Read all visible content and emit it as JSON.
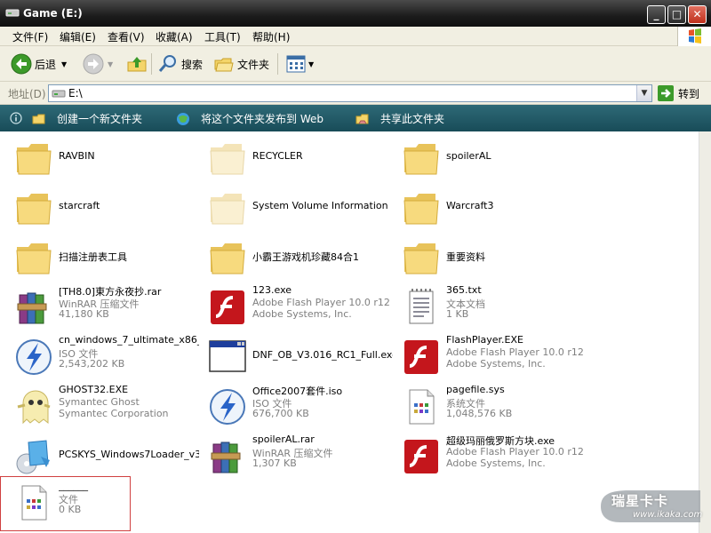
{
  "window": {
    "title": "Game (E:)",
    "min": "_",
    "max": "□",
    "close": "✕"
  },
  "menu": [
    "文件(F)",
    "编辑(E)",
    "查看(V)",
    "收藏(A)",
    "工具(T)",
    "帮助(H)"
  ],
  "toolbar": {
    "back": "后退",
    "search": "搜索",
    "folders": "文件夹"
  },
  "address": {
    "label": "地址(D)",
    "value": "E:\\",
    "go": "转到"
  },
  "tasks": [
    "创建一个新文件夹",
    "将这个文件夹发布到 Web",
    "共享此文件夹"
  ],
  "files": [
    {
      "name": "RAVBIN",
      "icon": "folder-icon"
    },
    {
      "name": "RECYCLER",
      "icon": "folder-hidden-icon"
    },
    {
      "name": "spoilerAL",
      "icon": "folder-icon"
    },
    {
      "name": "starcraft",
      "icon": "folder-icon"
    },
    {
      "name": "System Volume Information",
      "icon": "folder-hidden-icon"
    },
    {
      "name": "Warcraft3",
      "icon": "folder-icon"
    },
    {
      "name": "扫描注册表工具",
      "icon": "folder-icon"
    },
    {
      "name": "小霸王游戏机珍藏84合1",
      "icon": "folder-icon"
    },
    {
      "name": "重要资料",
      "icon": "folder-icon"
    },
    {
      "name": "[TH8.0]東方永夜抄.rar",
      "l2": "WinRAR 压缩文件",
      "l3": "41,180 KB",
      "icon": "winrar-icon"
    },
    {
      "name": "123.exe",
      "l2": "Adobe Flash Player 10.0 r12",
      "l3": "Adobe Systems, Inc.",
      "icon": "flash-icon"
    },
    {
      "name": "365.txt",
      "l2": "文本文档",
      "l3": "1 KB",
      "icon": "text-file-icon"
    },
    {
      "name": "cn_windows_7_ultimate_x86_...",
      "l2": "ISO 文件",
      "l3": "2,543,202 KB",
      "icon": "daemon-tools-icon"
    },
    {
      "name": "DNF_OB_V3.016_RC1_Full.exe",
      "l2": "",
      "l3": "",
      "icon": "window-app-icon"
    },
    {
      "name": "FlashPlayer.EXE",
      "l2": "Adobe Flash Player 10.0 r12",
      "l3": "Adobe Systems, Inc.",
      "icon": "flash-icon"
    },
    {
      "name": "GHOST32.EXE",
      "l2": "Symantec Ghost",
      "l3": "Symantec Corporation",
      "icon": "ghost-icon"
    },
    {
      "name": "Office2007套件.iso",
      "l2": "ISO 文件",
      "l3": "676,700 KB",
      "icon": "daemon-tools-icon"
    },
    {
      "name": "pagefile.sys",
      "l2": "系统文件",
      "l3": "1,048,576 KB",
      "icon": "system-file-icon"
    },
    {
      "name": "PCSKYS_Windows7Loader_v3...",
      "l2": "",
      "l3": "",
      "icon": "win7-loader-icon"
    },
    {
      "name": "spoilerAL.rar",
      "l2": "WinRAR 压缩文件",
      "l3": "1,307 KB",
      "icon": "winrar-icon"
    },
    {
      "name": "超级玛丽俄罗斯方块.exe",
      "l2": "Adobe Flash Player 10.0 r12",
      "l3": "Adobe Systems, Inc.",
      "icon": "flash-icon"
    },
    {
      "name": "______",
      "l2": "文件",
      "l3": "0 KB",
      "icon": "system-file-icon"
    }
  ],
  "watermark": {
    "text": "瑞星卡卡",
    "url": "www.ikaka.com"
  }
}
